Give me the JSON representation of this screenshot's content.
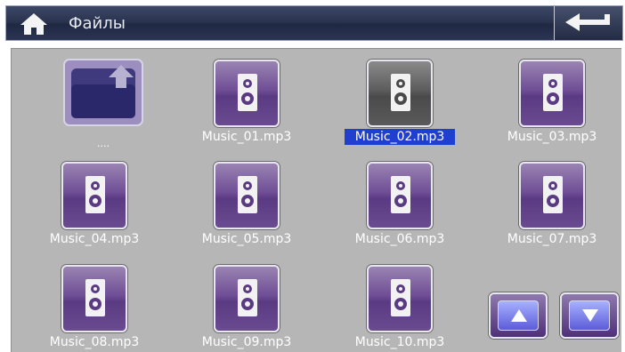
{
  "header": {
    "title": "Файлы"
  },
  "files": [
    {
      "name": "....",
      "kind": "parent-folder",
      "selected": false
    },
    {
      "name": "Music_01.mp3",
      "kind": "music",
      "selected": false
    },
    {
      "name": "Music_02.mp3",
      "kind": "music",
      "selected": true
    },
    {
      "name": "Music_03.mp3",
      "kind": "music",
      "selected": false
    },
    {
      "name": "Music_04.mp3",
      "kind": "music",
      "selected": false
    },
    {
      "name": "Music_05.mp3",
      "kind": "music",
      "selected": false
    },
    {
      "name": "Music_06.mp3",
      "kind": "music",
      "selected": false
    },
    {
      "name": "Music_07.mp3",
      "kind": "music",
      "selected": false
    },
    {
      "name": "Music_08.mp3",
      "kind": "music",
      "selected": false
    },
    {
      "name": "Music_09.mp3",
      "kind": "music",
      "selected": false
    },
    {
      "name": "Music_10.mp3",
      "kind": "music",
      "selected": false
    }
  ],
  "icons": {
    "home": "home-icon",
    "back": "back-arrow-icon",
    "up": "arrow-up-icon",
    "down": "arrow-down-icon"
  },
  "colors": {
    "header": "#2a3450",
    "panel": "#b6b6b6",
    "accent": "#5a3a82",
    "selection": "#1f3fd0"
  }
}
